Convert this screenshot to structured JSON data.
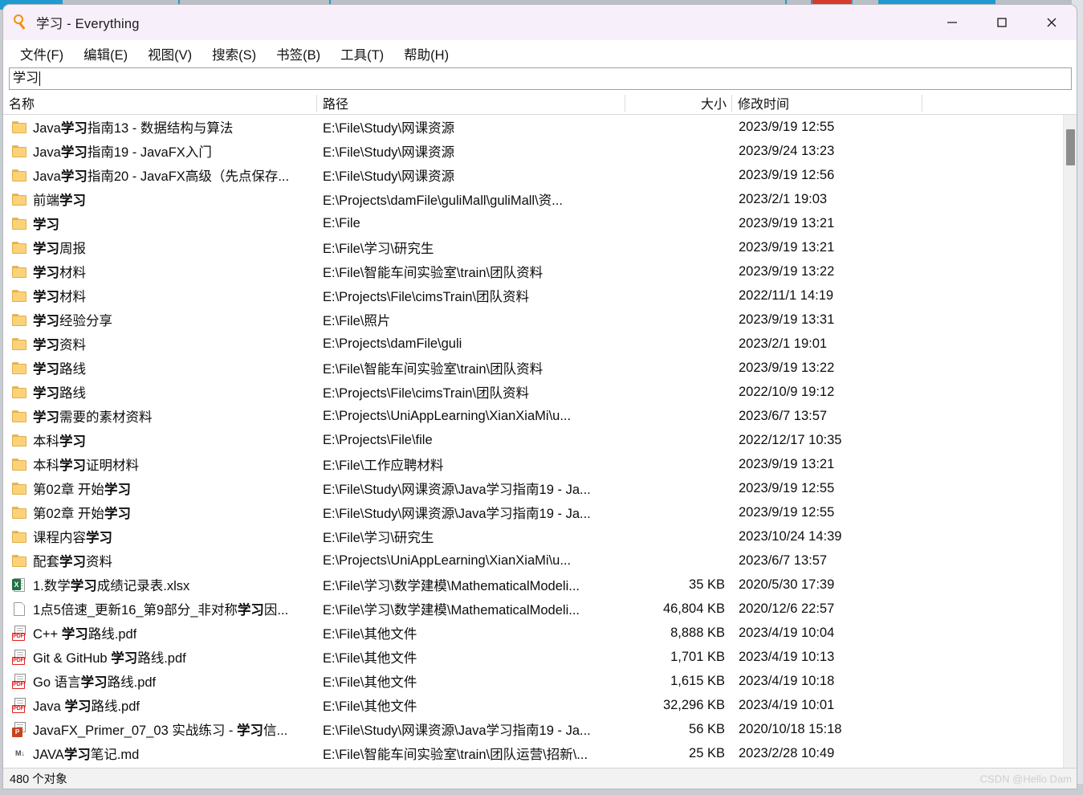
{
  "window": {
    "title": "学习 - Everything",
    "app_icon": "magnifier-icon",
    "minimize_label": "—",
    "maximize_label": "□",
    "close_label": "✕"
  },
  "menubar": {
    "items": [
      {
        "label": "文件(F)",
        "name": "menu-file"
      },
      {
        "label": "编辑(E)",
        "name": "menu-edit"
      },
      {
        "label": "视图(V)",
        "name": "menu-view"
      },
      {
        "label": "搜索(S)",
        "name": "menu-search"
      },
      {
        "label": "书签(B)",
        "name": "menu-bookmark"
      },
      {
        "label": "工具(T)",
        "name": "menu-tools"
      },
      {
        "label": "帮助(H)",
        "name": "menu-help"
      }
    ]
  },
  "search": {
    "value": "学习",
    "placeholder": ""
  },
  "columns": {
    "name": "名称",
    "path": "路径",
    "size": "大小",
    "date": "修改时间"
  },
  "rows": [
    {
      "icon": "folder",
      "name_pre": "Java",
      "name_hit": "学习",
      "name_post": "指南13 - 数据结构与算法",
      "path": "E:\\File\\Study\\网课资源",
      "size": "",
      "date": "2023/9/19 12:55"
    },
    {
      "icon": "folder",
      "name_pre": "Java",
      "name_hit": "学习",
      "name_post": "指南19 - JavaFX入门",
      "path": "E:\\File\\Study\\网课资源",
      "size": "",
      "date": "2023/9/24 13:23"
    },
    {
      "icon": "folder",
      "name_pre": "Java",
      "name_hit": "学习",
      "name_post": "指南20 - JavaFX高级（先点保存...",
      "path": "E:\\File\\Study\\网课资源",
      "size": "",
      "date": "2023/9/19 12:56"
    },
    {
      "icon": "folder",
      "name_pre": "前端",
      "name_hit": "学习",
      "name_post": "",
      "path": "E:\\Projects\\damFile\\guliMall\\guliMall\\资...",
      "size": "",
      "date": "2023/2/1 19:03"
    },
    {
      "icon": "folder",
      "name_pre": "",
      "name_hit": "学习",
      "name_post": "",
      "path": "E:\\File",
      "size": "",
      "date": "2023/9/19 13:21"
    },
    {
      "icon": "folder",
      "name_pre": "",
      "name_hit": "学习",
      "name_post": "周报",
      "path": "E:\\File\\学习\\研究生",
      "size": "",
      "date": "2023/9/19 13:21"
    },
    {
      "icon": "folder",
      "name_pre": "",
      "name_hit": "学习",
      "name_post": "材料",
      "path": "E:\\File\\智能车间实验室\\train\\团队资料",
      "size": "",
      "date": "2023/9/19 13:22"
    },
    {
      "icon": "folder",
      "name_pre": "",
      "name_hit": "学习",
      "name_post": "材料",
      "path": "E:\\Projects\\File\\cimsTrain\\团队资料",
      "size": "",
      "date": "2022/11/1 14:19"
    },
    {
      "icon": "folder",
      "name_pre": "",
      "name_hit": "学习",
      "name_post": "经验分享",
      "path": "E:\\File\\照片",
      "size": "",
      "date": "2023/9/19 13:31"
    },
    {
      "icon": "folder",
      "name_pre": "",
      "name_hit": "学习",
      "name_post": "资料",
      "path": "E:\\Projects\\damFile\\guli",
      "size": "",
      "date": "2023/2/1 19:01"
    },
    {
      "icon": "folder",
      "name_pre": "",
      "name_hit": "学习",
      "name_post": "路线",
      "path": "E:\\File\\智能车间实验室\\train\\团队资料",
      "size": "",
      "date": "2023/9/19 13:22"
    },
    {
      "icon": "folder",
      "name_pre": "",
      "name_hit": "学习",
      "name_post": "路线",
      "path": "E:\\Projects\\File\\cimsTrain\\团队资料",
      "size": "",
      "date": "2022/10/9 19:12"
    },
    {
      "icon": "folder",
      "name_pre": "",
      "name_hit": "学习",
      "name_post": "需要的素材资料",
      "path": "E:\\Projects\\UniAppLearning\\XianXiaMi\\u...",
      "size": "",
      "date": "2023/6/7 13:57"
    },
    {
      "icon": "folder",
      "name_pre": "本科",
      "name_hit": "学习",
      "name_post": "",
      "path": "E:\\Projects\\File\\file",
      "size": "",
      "date": "2022/12/17 10:35"
    },
    {
      "icon": "folder",
      "name_pre": "本科",
      "name_hit": "学习",
      "name_post": "证明材料",
      "path": "E:\\File\\工作应聘材料",
      "size": "",
      "date": "2023/9/19 13:21"
    },
    {
      "icon": "folder",
      "name_pre": "第02章 开始",
      "name_hit": "学习",
      "name_post": "",
      "path": "E:\\File\\Study\\网课资源\\Java学习指南19 - Ja...",
      "size": "",
      "date": "2023/9/19 12:55"
    },
    {
      "icon": "folder",
      "name_pre": "第02章 开始",
      "name_hit": "学习",
      "name_post": "",
      "path": "E:\\File\\Study\\网课资源\\Java学习指南19 - Ja...",
      "size": "",
      "date": "2023/9/19 12:55"
    },
    {
      "icon": "folder",
      "name_pre": "课程内容",
      "name_hit": "学习",
      "name_post": "",
      "path": "E:\\File\\学习\\研究生",
      "size": "",
      "date": "2023/10/24 14:39"
    },
    {
      "icon": "folder",
      "name_pre": "配套",
      "name_hit": "学习",
      "name_post": "资料",
      "path": "E:\\Projects\\UniAppLearning\\XianXiaMi\\u...",
      "size": "",
      "date": "2023/6/7 13:57"
    },
    {
      "icon": "xlsx",
      "name_pre": "1.数学",
      "name_hit": "学习",
      "name_post": "成绩记录表.xlsx",
      "path": "E:\\File\\学习\\数学建模\\MathematicalModeli...",
      "size": "35 KB",
      "date": "2020/5/30 17:39"
    },
    {
      "icon": "doc",
      "name_pre": "1点5倍速_更新16_第9部分_非对称",
      "name_hit": "学习",
      "name_post": "因...",
      "path": "E:\\File\\学习\\数学建模\\MathematicalModeli...",
      "size": "46,804 KB",
      "date": "2020/12/6 22:57"
    },
    {
      "icon": "pdf",
      "name_pre": "C++ ",
      "name_hit": "学习",
      "name_post": "路线.pdf",
      "path": "E:\\File\\其他文件",
      "size": "8,888 KB",
      "date": "2023/4/19 10:04"
    },
    {
      "icon": "pdf",
      "name_pre": "Git & GitHub ",
      "name_hit": "学习",
      "name_post": "路线.pdf",
      "path": "E:\\File\\其他文件",
      "size": "1,701 KB",
      "date": "2023/4/19 10:13"
    },
    {
      "icon": "pdf",
      "name_pre": "Go 语言",
      "name_hit": "学习",
      "name_post": "路线.pdf",
      "path": "E:\\File\\其他文件",
      "size": "1,615 KB",
      "date": "2023/4/19 10:18"
    },
    {
      "icon": "pdf",
      "name_pre": "Java ",
      "name_hit": "学习",
      "name_post": "路线.pdf",
      "path": "E:\\File\\其他文件",
      "size": "32,296 KB",
      "date": "2023/4/19 10:01"
    },
    {
      "icon": "pptx",
      "name_pre": "JavaFX_Primer_07_03 实战练习 - ",
      "name_hit": "学习",
      "name_post": "信...",
      "path": "E:\\File\\Study\\网课资源\\Java学习指南19 - Ja...",
      "size": "56 KB",
      "date": "2020/10/18 15:18"
    },
    {
      "icon": "md",
      "name_pre": "JAVA",
      "name_hit": "学习",
      "name_post": "笔记.md",
      "path": "E:\\File\\智能车间实验室\\train\\团队运营\\招新\\...",
      "size": "25 KB",
      "date": "2023/2/28 10:49"
    }
  ],
  "statusbar": {
    "count_text": "480 个对象",
    "watermark": "CSDN @Hello Dam"
  }
}
